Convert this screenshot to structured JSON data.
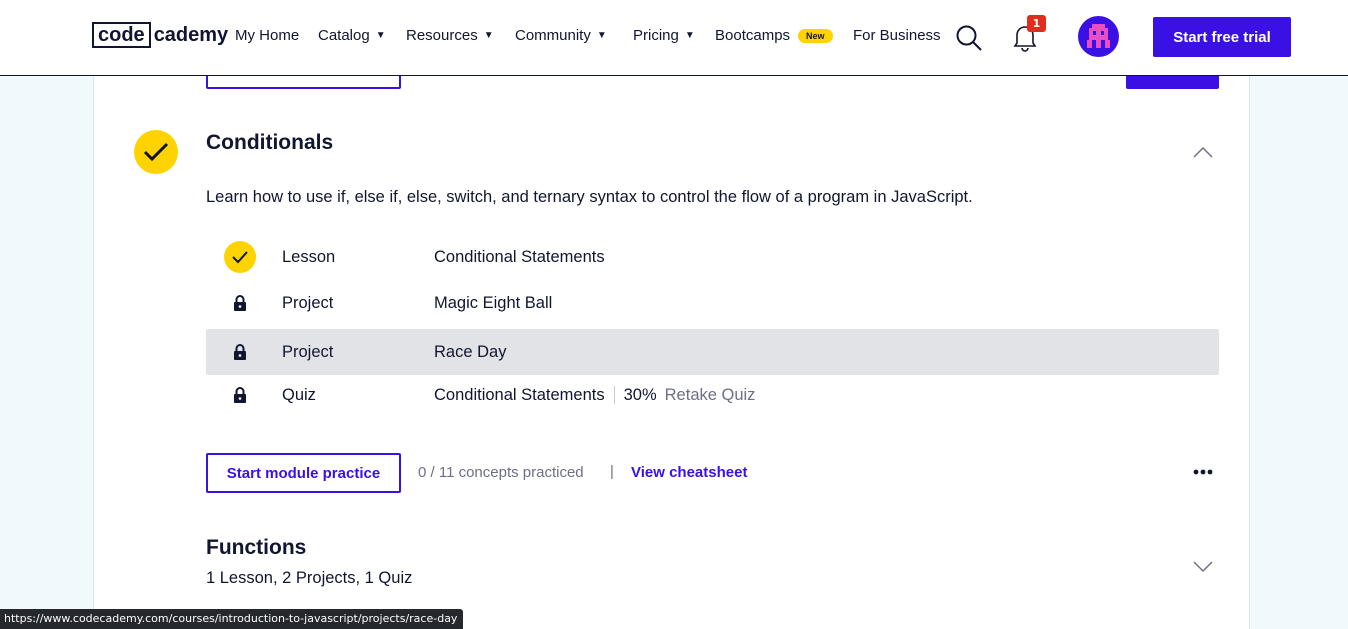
{
  "header": {
    "logo_left": "code",
    "logo_right": "cademy",
    "nav": {
      "my_home": "My Home",
      "catalog": "Catalog",
      "resources": "Resources",
      "community": "Community",
      "pricing": "Pricing",
      "bootcamps": "Bootcamps",
      "bootcamps_badge": "New",
      "for_business": "For Business"
    },
    "notifications_count": "1",
    "cta": "Start free trial"
  },
  "module": {
    "title": "Conditionals",
    "description": "Learn how to use if, else if, else, switch, and ternary syntax to control the flow of a program in JavaScript.",
    "items": [
      {
        "type": "Lesson",
        "title": "Conditional Statements",
        "status": "completed"
      },
      {
        "type": "Project",
        "title": "Magic Eight Ball",
        "status": "locked"
      },
      {
        "type": "Project",
        "title": "Race Day",
        "status": "locked"
      },
      {
        "type": "Quiz",
        "title": "Conditional Statements",
        "status": "locked",
        "score": "30%",
        "action": "Retake Quiz"
      }
    ],
    "practice_button": "Start module practice",
    "concepts_text": "0 / 11 concepts practiced",
    "separator": "|",
    "cheatsheet_link": "View cheatsheet"
  },
  "next_module": {
    "title": "Functions",
    "summary": "1 Lesson, 2 Projects, 1 Quiz"
  },
  "status_bar": {
    "url": "https://www.codecademy.com/courses/introduction-to-javascript/projects/race-day"
  },
  "colors": {
    "brand": "#3a10e5",
    "accent": "#ffd300",
    "text": "#10162f",
    "background": "#f0fafd"
  }
}
